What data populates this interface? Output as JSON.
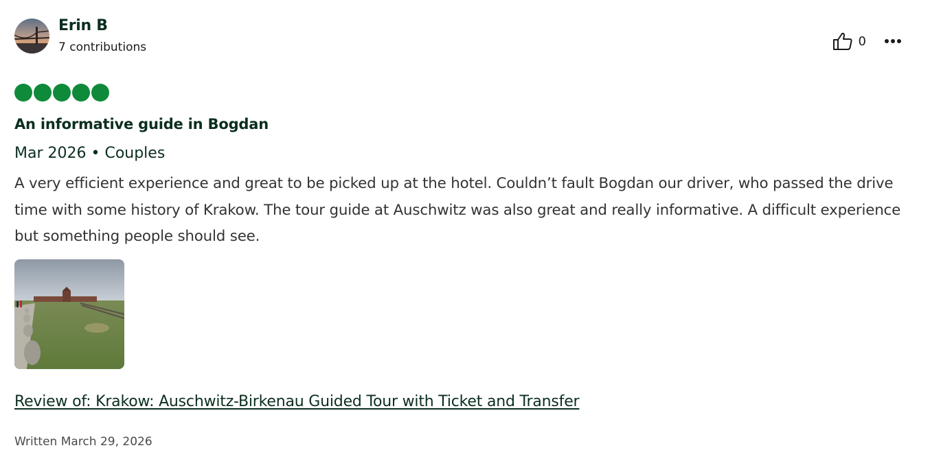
{
  "review": {
    "user": {
      "name": "Erin B",
      "contributions": "7 contributions"
    },
    "helpful_count": "0",
    "rating": {
      "value": 5,
      "max": 5,
      "color": "#0e8a3a"
    },
    "title": "An informative guide in Bogdan",
    "meta": "Mar 2026 • Couples",
    "body": "A very efficient experience and great to be picked up at the hotel. Couldn’t fault Bogdan our driver, who passed the drive time with some history of Krakow. The tour guide at Auschwitz was also great and really informative. A difficult experience but something people should see.",
    "review_of": "Review of: Krakow: Auschwitz-Birkenau Guided Tour with Ticket and Transfer",
    "written": "Written March 29, 2026"
  },
  "icons": {
    "helpful": "thumbs-up-icon",
    "more": "more-options-icon"
  },
  "colors": {
    "heading": "#0b2e1e",
    "bubble": "#0e8a3a"
  }
}
